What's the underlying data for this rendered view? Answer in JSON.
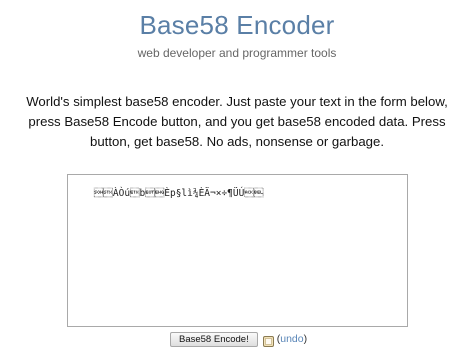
{
  "header": {
    "title": "Base58 Encoder",
    "subtitle": "web developer and programmer tools"
  },
  "intro": {
    "text": "World's simplest base58 encoder. Just paste your text in the form below, press Base58 Encode button, and you get base58 encoded data. Press button, get base58. No ads, nonsense or garbage."
  },
  "editor": {
    "value": "\u0001\u0002ÀÒú\u0003b\u0004\u0005Èp§lì¾ÈÄ¬×÷¶ÜÚ\u0006\u0007"
  },
  "controls": {
    "encode_label": "Base58 Encode!",
    "undo_open": "(",
    "undo_label": "undo",
    "undo_close": ")"
  },
  "icons": {
    "resize_handle": "resize-grip-icon",
    "checkbox": "checkbox-icon"
  }
}
